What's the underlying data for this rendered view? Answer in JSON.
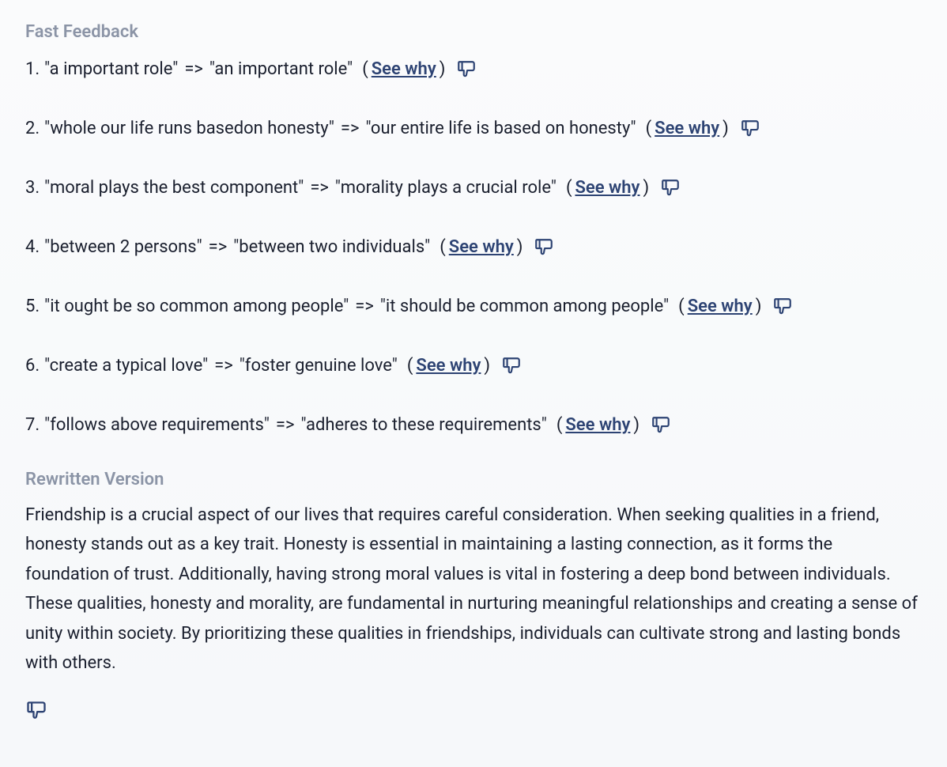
{
  "sections": {
    "feedback_heading": "Fast Feedback",
    "rewritten_heading": "Rewritten Version"
  },
  "link_label": "See why",
  "arrow": "=>",
  "feedback": [
    {
      "num": "1.",
      "original": "\"a important role\"",
      "corrected": "\"an important role\""
    },
    {
      "num": "2.",
      "original": "\"whole our life runs basedon honesty\"",
      "corrected": "\"our entire life is based on honesty\""
    },
    {
      "num": "3.",
      "original": "\"moral plays the best component\"",
      "corrected": "\"morality plays a crucial role\""
    },
    {
      "num": "4.",
      "original": "\"between 2 persons\"",
      "corrected": "\"between two individuals\""
    },
    {
      "num": "5.",
      "original": "\"it ought be so common among people\"",
      "corrected": "\"it should be common among people\""
    },
    {
      "num": "6.",
      "original": "\"create a typical love\"",
      "corrected": "\"foster genuine love\""
    },
    {
      "num": "7.",
      "original": "\"follows above requirements\"",
      "corrected": "\"adheres to these requirements\""
    }
  ],
  "rewritten": "Friendship is a crucial aspect of our lives that requires careful consideration. When seeking qualities in a friend, honesty stands out as a key trait. Honesty is essential in maintaining a lasting connection, as it forms the foundation of trust. Additionally, having strong moral values is vital in fostering a deep bond between individuals. These qualities, honesty and morality, are fundamental in nurturing meaningful relationships and creating a sense of unity within society. By prioritizing these qualities in friendships, individuals can cultivate strong and lasting bonds with others."
}
